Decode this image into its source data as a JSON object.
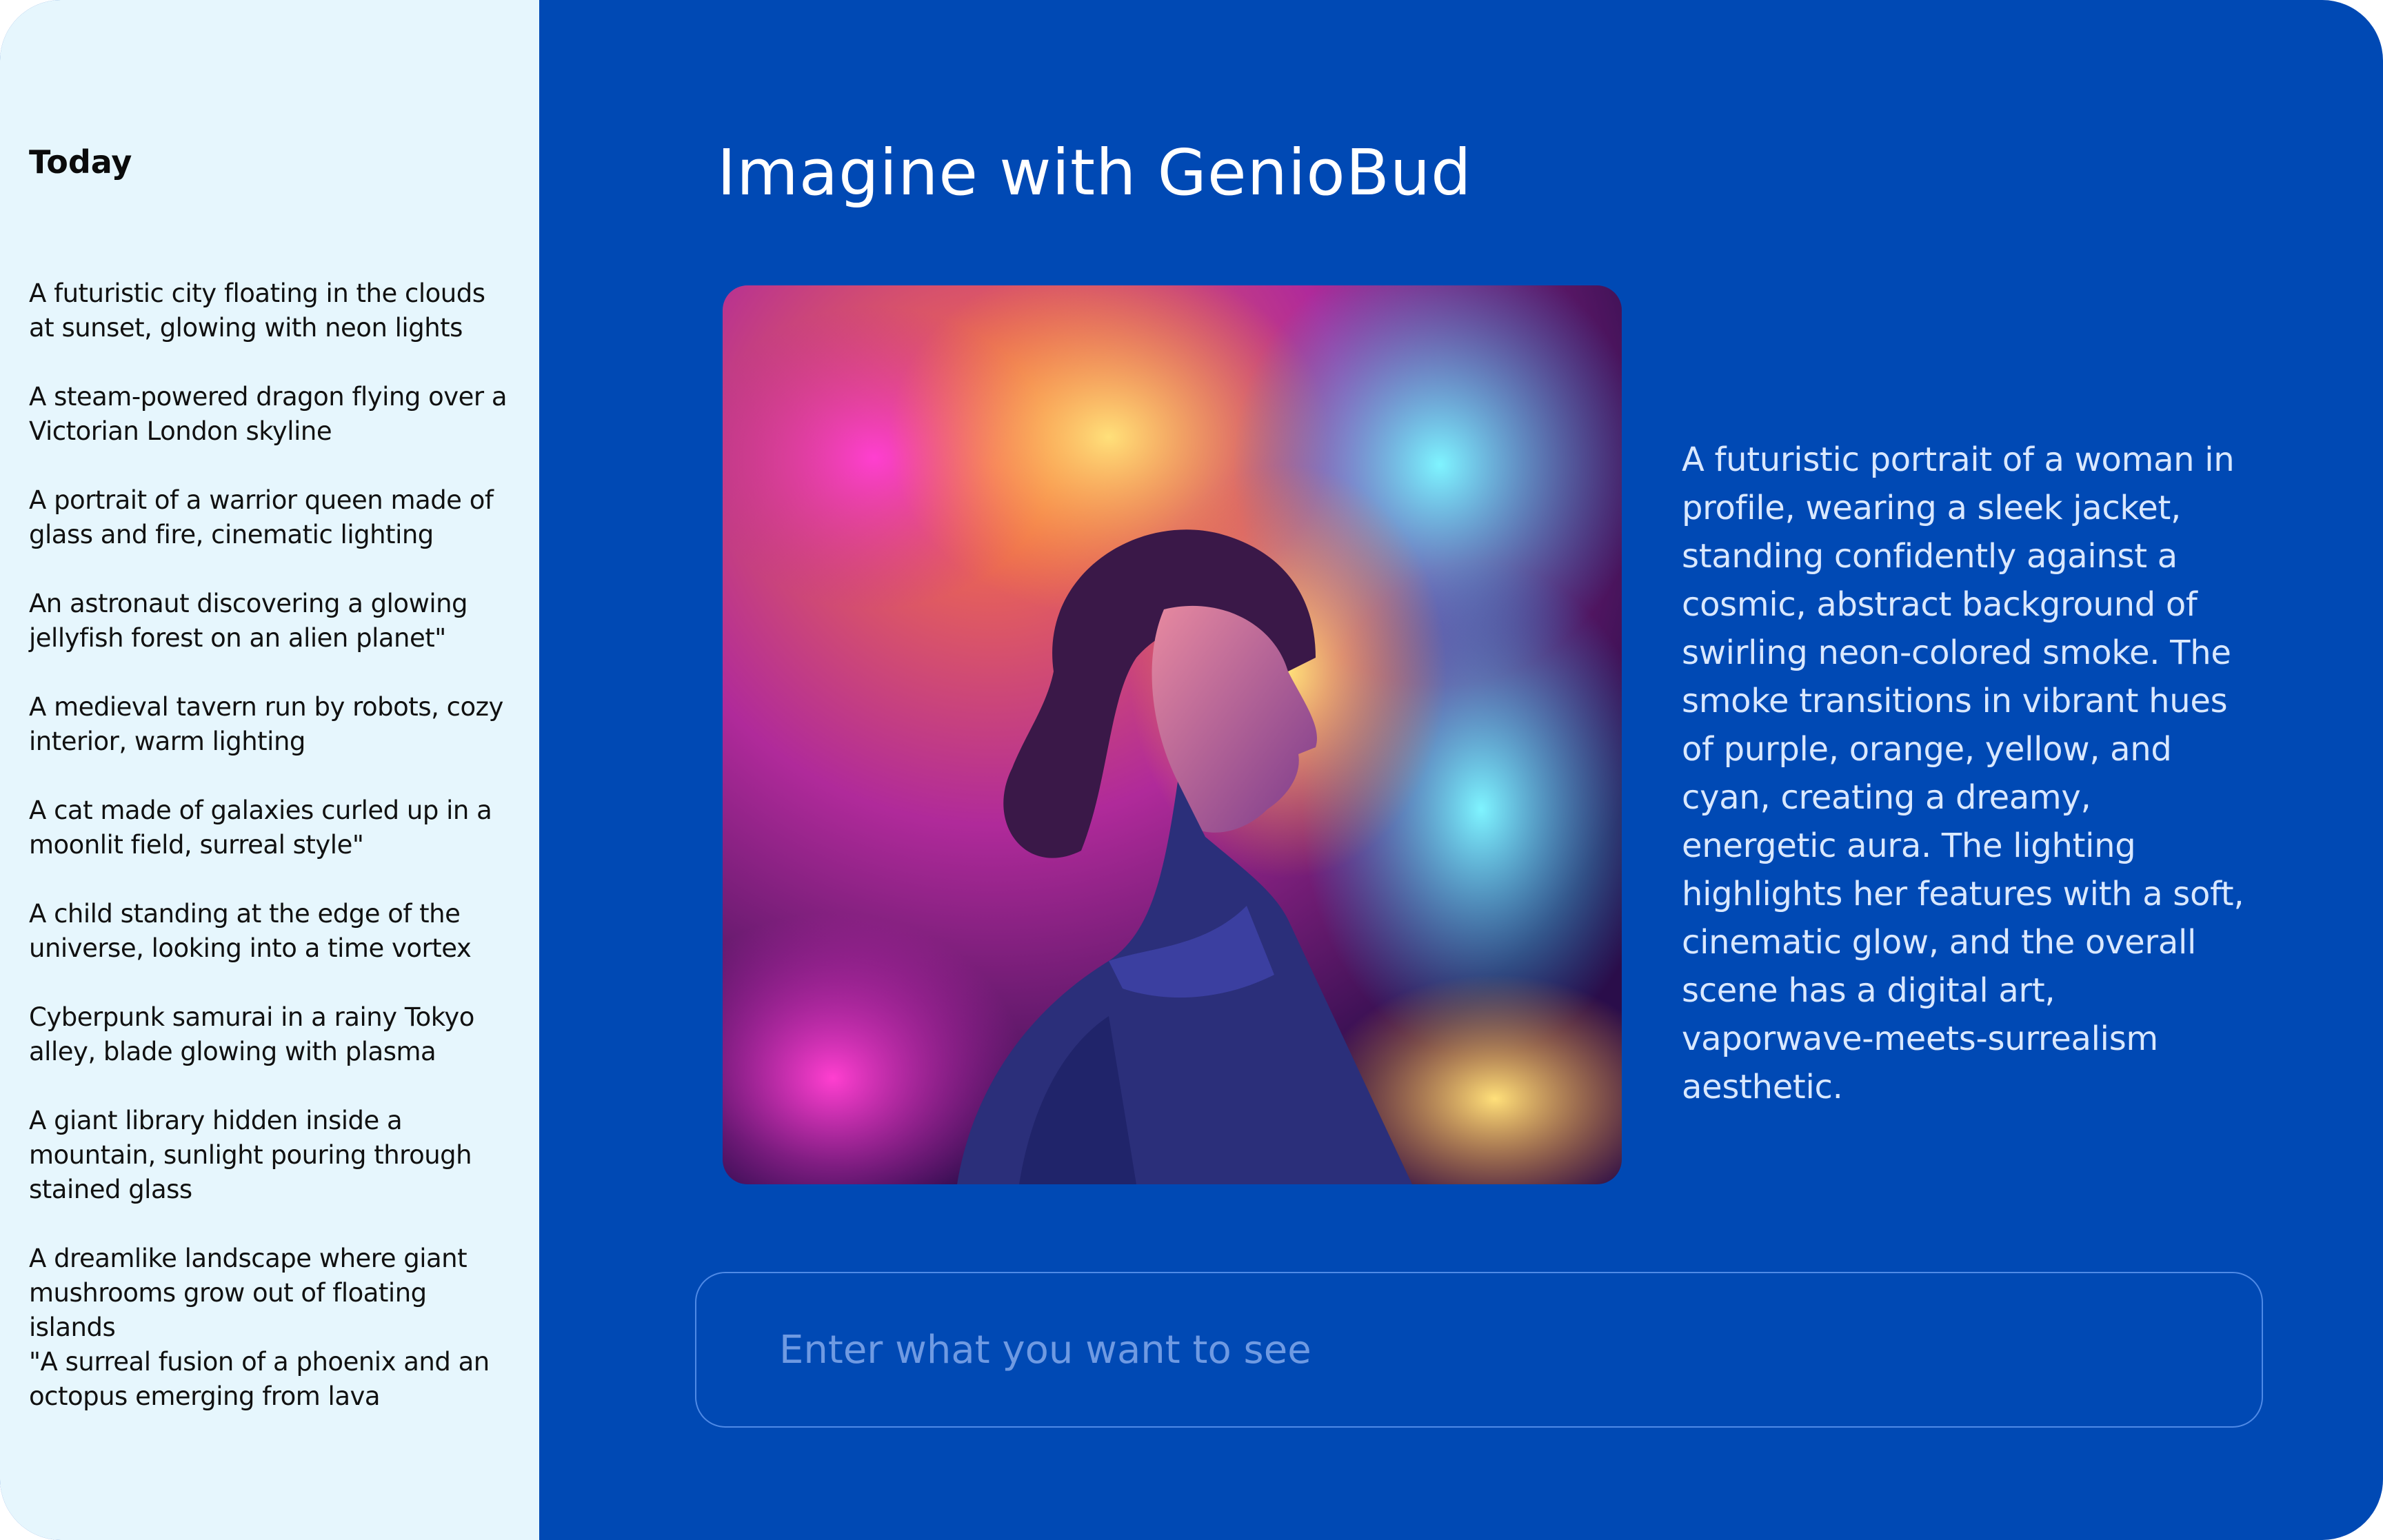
{
  "sidebar": {
    "heading": "Today",
    "items": [
      {
        "label": "A futuristic city floating in the clouds\nat sunset, glowing with neon lights"
      },
      {
        "label": "A steam-powered dragon flying over a\n Victorian London skyline"
      },
      {
        "label": "A portrait of a warrior queen made of\nglass and fire, cinematic lighting"
      },
      {
        "label": "An astronaut discovering a glowing\njellyfish forest on an alien planet\""
      },
      {
        "label": "A medieval tavern run by robots, cozy\n interior, warm lighting"
      },
      {
        "label": "A cat made of galaxies curled up in a\nmoonlit field, surreal style\""
      },
      {
        "label": "A child standing at the edge of the\nuniverse, looking into a time vortex"
      },
      {
        "label": "Cyberpunk samurai in a rainy Tokyo\nalley, blade glowing with plasma"
      },
      {
        "label": "A giant library hidden inside a\nmountain, sunlight pouring through\nstained glass"
      },
      {
        "label": "A dreamlike landscape where giant\nmushrooms grow out of floating\nislands"
      },
      {
        "label": "\"A surreal fusion of a phoenix and an\noctopus emerging from lava"
      }
    ]
  },
  "main": {
    "title": "Imagine with GenioBud",
    "image_icon": "generated-portrait-image",
    "description": "A futuristic portrait of a woman in profile, wearing a sleek jacket, standing confidently against a cosmic, abstract background of swirling neon-colored smoke. The smoke transitions in vibrant hues of purple, orange, yellow, and cyan, creating a dreamy, energetic aura. The lighting highlights her features with a soft, cinematic glow, and the overall scene has a digital art, vaporwave-meets-surrealism aesthetic.",
    "prompt_placeholder": "Enter what you want to see",
    "prompt_value": ""
  },
  "colors": {
    "main_bg": "#0049b4",
    "sidebar_bg": "#e6f6fd",
    "prompt_border": "#4f8ae6",
    "placeholder": "#6f9ae2"
  }
}
